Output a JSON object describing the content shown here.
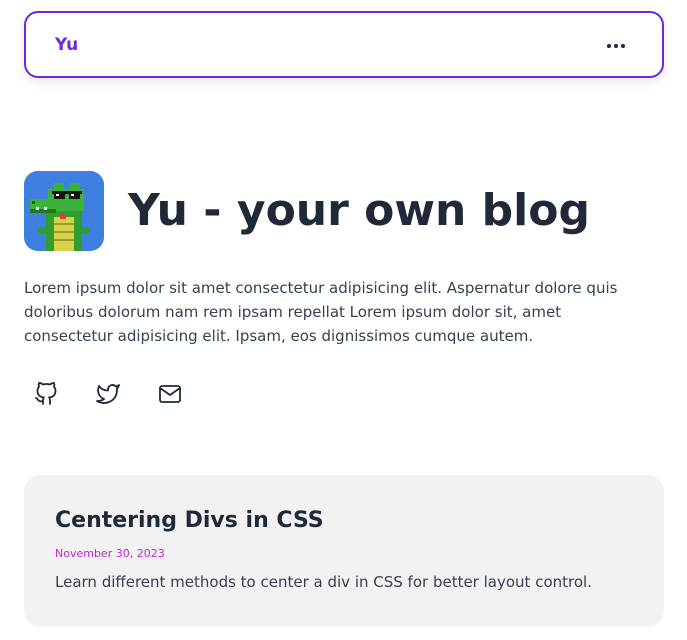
{
  "nav": {
    "brand": "Yu",
    "menu_icon": "more-horizontal-icon"
  },
  "hero": {
    "avatar_icon": "pixel-crocodile-with-sunglasses",
    "title": "Yu - your own blog",
    "description": "Lorem ipsum dolor sit amet consectetur adipisicing elit. Aspernatur dolore quis doloribus dolorum nam rem ipsam repellat Lorem ipsum dolor sit, amet consectetur adipisicing elit. Ipsam, eos dignissimos cumque autem."
  },
  "socials": [
    {
      "icon": "github-icon"
    },
    {
      "icon": "twitter-icon"
    },
    {
      "icon": "mail-icon"
    }
  ],
  "posts": [
    {
      "title": "Centering Divs in CSS",
      "date": "November 30, 2023",
      "excerpt": "Learn different methods to center a div in CSS for better layout control."
    }
  ],
  "colors": {
    "accent": "#6d28d9",
    "date": "#c026d3",
    "card_bg": "#f2f2f2",
    "text": "#1f2937"
  }
}
